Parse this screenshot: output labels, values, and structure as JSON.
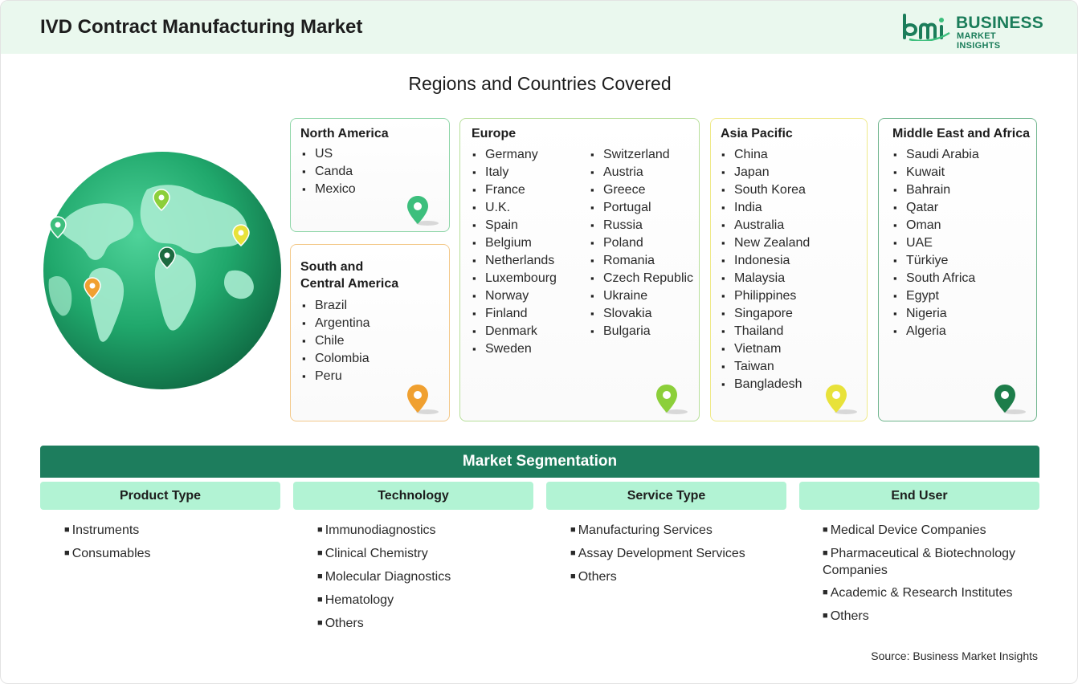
{
  "header": {
    "title": "IVD Contract Manufacturing Market",
    "logo_line1": "BUSINESS",
    "logo_line2": "MARKET INSIGHTS",
    "background": "#eaf8ee",
    "brand_color": "#1b7d5a"
  },
  "regions_title": "Regions and Countries Covered",
  "regions": {
    "north_america": {
      "title": "North America",
      "countries": [
        "US",
        "Canda",
        "Mexico"
      ],
      "pin_color": "#3dbf7d"
    },
    "south_central_america": {
      "title_line1": "South and",
      "title_line2": "Central America",
      "countries": [
        "Brazil",
        "Argentina",
        "Chile",
        "Colombia",
        "Peru"
      ],
      "pin_color": "#f0a030"
    },
    "europe": {
      "title": "Europe",
      "countries_col1": [
        "Germany",
        "Italy",
        "France",
        "U.K.",
        "Spain",
        "Belgium",
        "Netherlands",
        "Luxembourg",
        "Norway",
        "Finland",
        "Denmark",
        "Sweden"
      ],
      "countries_col2": [
        "Switzerland",
        "Austria",
        "Greece",
        "Portugal",
        "Russia",
        "Poland",
        "Romania",
        "Czech Republic",
        "Ukraine",
        "Slovakia",
        "Bulgaria"
      ],
      "pin_color": "#8ccf3a"
    },
    "asia_pacific": {
      "title": "Asia Pacific",
      "countries": [
        "China",
        "Japan",
        "South Korea",
        "India",
        "Australia",
        "New Zealand",
        "Indonesia",
        "Malaysia",
        "Philippines",
        "Singapore",
        "Thailand",
        "Vietnam",
        "Taiwan",
        "Bangladesh"
      ],
      "pin_color": "#e8e23a"
    },
    "middle_east_africa": {
      "title": "Middle East and Africa",
      "countries": [
        "Saudi Arabia",
        "Kuwait",
        "Bahrain",
        "Qatar",
        "Oman",
        "UAE",
        "Türkiye",
        "South Africa",
        "Egypt",
        "Nigeria",
        "Algeria"
      ],
      "pin_color": "#1d7d4a"
    }
  },
  "segmentation": {
    "banner": "Market Segmentation",
    "banner_color": "#1d7d5d",
    "columns": [
      {
        "title": "Product Type",
        "items": [
          "Instruments",
          "Consumables"
        ]
      },
      {
        "title": "Technology",
        "items": [
          "Immunodiagnostics",
          "Clinical Chemistry",
          "Molecular Diagnostics",
          "Hematology",
          "Others"
        ]
      },
      {
        "title": "Service Type",
        "items": [
          "Manufacturing Services",
          "Assay Development Services",
          "Others"
        ]
      },
      {
        "title": "End User",
        "items": [
          "Medical Device Companies",
          "Pharmaceutical & Biotechnology Companies",
          "Academic & Research Institutes",
          "Others"
        ]
      }
    ]
  },
  "source": "Source: Business Market Insights"
}
